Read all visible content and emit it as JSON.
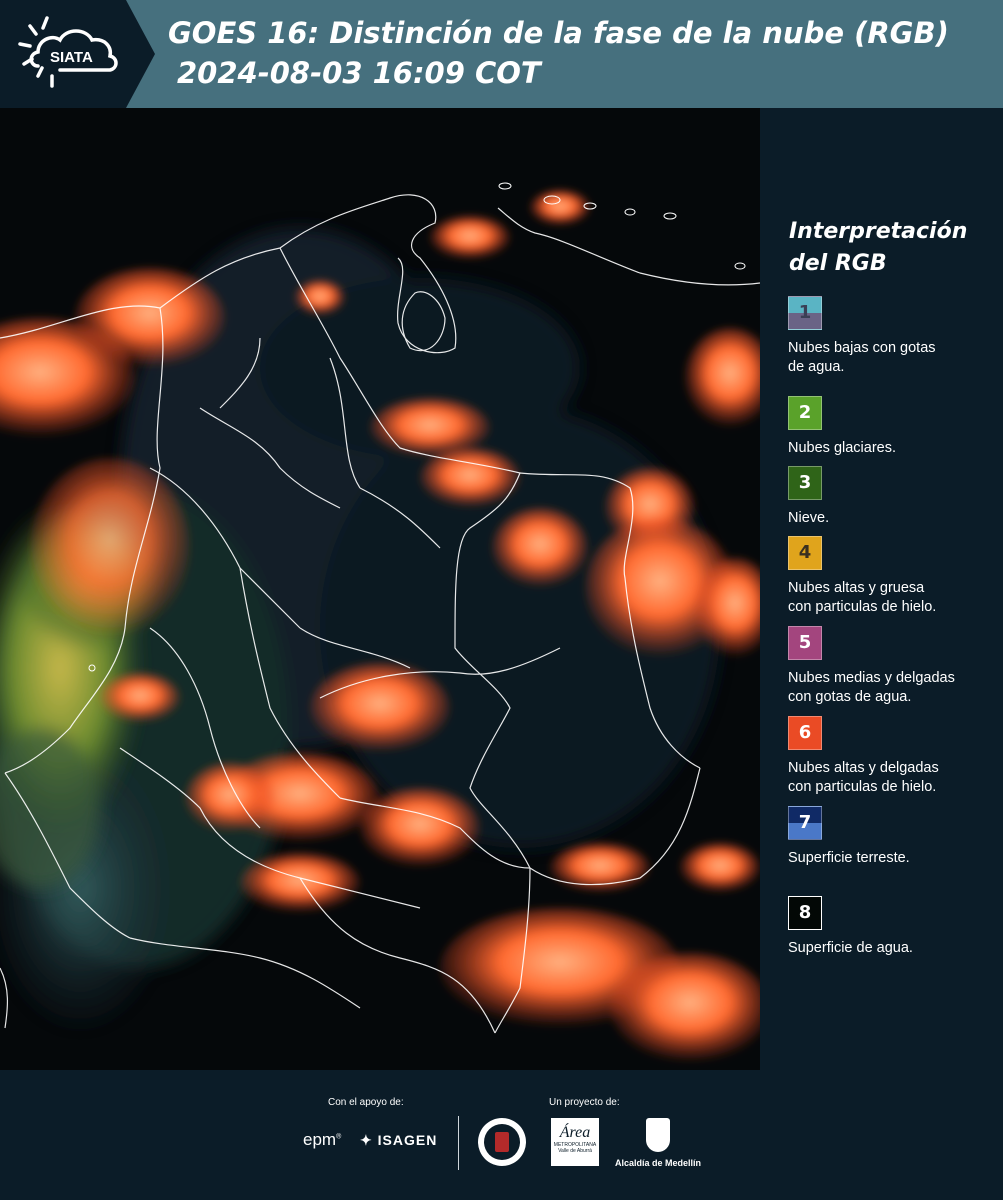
{
  "header": {
    "logo_text": "SIATA",
    "title_line1": "GOES 16: Distinción de la fase de la nube (RGB)",
    "title_line2": "2024-08-03 16:09 COT"
  },
  "legend": {
    "title_line1": "Interpretación",
    "title_line2": "del RGB",
    "items": [
      {
        "number": "1",
        "label_line1": "Nubes bajas con gotas",
        "label_line2": "de agua.",
        "color_top": "#5ab4c4",
        "color_bottom": "#6a6386",
        "number_color": "#3a3f55"
      },
      {
        "number": "2",
        "label_line1": "Nubes glaciares.",
        "label_line2": "",
        "color_top": "#5aa22a",
        "color_bottom": "#5aa22a",
        "number_color": "#ffffff"
      },
      {
        "number": "3",
        "label_line1": "Nieve.",
        "label_line2": "",
        "color_top": "#2f6418",
        "color_bottom": "#2f6418",
        "number_color": "#ffffff"
      },
      {
        "number": "4",
        "label_line1": "Nubes altas y gruesa",
        "label_line2": "con particulas de hielo.",
        "color_top": "#e0a41c",
        "color_bottom": "#e0a41c",
        "number_color": "#3a3020"
      },
      {
        "number": "5",
        "label_line1": "Nubes medias y delgadas",
        "label_line2": "con gotas de agua.",
        "color_top": "#a3457e",
        "color_bottom": "#a3457e",
        "number_color": "#ffffff"
      },
      {
        "number": "6",
        "label_line1": "Nubes altas y delgadas",
        "label_line2": "con particulas de hielo.",
        "color_top": "#ea4b25",
        "color_bottom": "#ea4b25",
        "number_color": "#ffffff"
      },
      {
        "number": "7",
        "label_line1": "Superficie terreste.",
        "label_line2": "",
        "color_top": "#102a66",
        "color_bottom": "#4a78c8",
        "number_color": "#ffffff"
      },
      {
        "number": "8",
        "label_line1": "Superficie de agua.",
        "label_line2": "",
        "color_top": "#030806",
        "color_bottom": "#030806",
        "number_color": "#ffffff"
      }
    ]
  },
  "footer": {
    "support_label": "Con el apoyo de:",
    "project_label": "Un proyecto de:",
    "epm_text": "epm",
    "isagen_text": "ISAGEN",
    "area_text": "Área",
    "metropolitana_text": "METROPOLITANA",
    "valle_text": "Valle de Aburrá",
    "alcaldia_text": "Alcaldía de Medellín"
  },
  "colors": {
    "header_bg": "#46707e",
    "logo_bg": "#0b1c28",
    "page_bg": "#0b1c28",
    "cloud_ice": "#ff6a30",
    "map_bg": "#05080a"
  }
}
